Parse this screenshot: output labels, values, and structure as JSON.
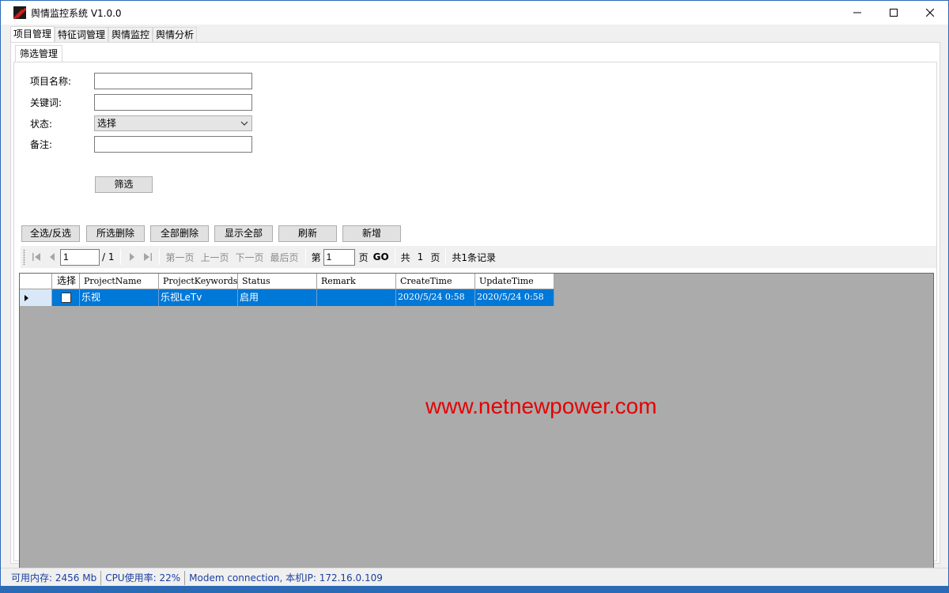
{
  "window": {
    "title": "舆情监控系统 V1.0.0"
  },
  "main_tabs": [
    {
      "label": "项目管理",
      "active": true
    },
    {
      "label": "特征词管理",
      "active": false
    },
    {
      "label": "舆情监控",
      "active": false
    },
    {
      "label": "舆情分析",
      "active": false
    }
  ],
  "sub_tab": {
    "label": "筛选管理"
  },
  "form": {
    "project_name_label": "项目名称:",
    "project_name_value": "",
    "keyword_label": "关键词:",
    "keyword_value": "",
    "status_label": "状态:",
    "status_selected": "选择",
    "remark_label": "备注:",
    "remark_value": "",
    "filter_button": "筛选"
  },
  "actions": {
    "select_all": "全选/反选",
    "delete_selected": "所选删除",
    "delete_all": "全部删除",
    "show_all": "显示全部",
    "refresh": "刷新",
    "add_new": "新增"
  },
  "pager": {
    "current_page": "1",
    "total_pages_text": "/ 1",
    "first": "第一页",
    "prev": "上一页",
    "next": "下一页",
    "last": "最后页",
    "goto_prefix": "第",
    "goto_value": "1",
    "goto_suffix": "页",
    "go": "GO",
    "total_prefix": "共",
    "total_pages": "1",
    "total_suffix": "页",
    "records": "共1条记录"
  },
  "grid": {
    "columns": [
      "选择",
      "ProjectName",
      "ProjectKeywords",
      "Status",
      "Remark",
      "CreateTime",
      "UpdateTime"
    ],
    "rows": [
      {
        "checked": false,
        "project_name": "乐视",
        "project_keywords": "乐视LeTv",
        "status": "启用",
        "remark": "",
        "create_time": "2020/5/24 0:58",
        "update_time": "2020/5/24 0:58"
      }
    ]
  },
  "watermark": "www.netnewpower.com",
  "status_bar": {
    "memory": "可用内存: 2456 Mb",
    "cpu": "CPU使用率: 22%",
    "network": "Modem connection, 本机IP: 172.16.0.109"
  },
  "colors": {
    "selection": "#0078d7",
    "grid_background": "#ababab",
    "status_text": "#1a3fa0",
    "watermark": "#e60000",
    "window_border": "#2b6bb5"
  }
}
